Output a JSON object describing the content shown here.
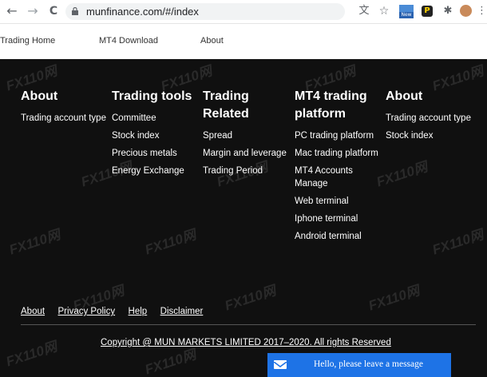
{
  "browser": {
    "back_icon": "←",
    "forward_icon": "→",
    "reload_icon": "C",
    "url": "munfinance.com/#/index",
    "ext_new_badge": "New"
  },
  "nav": {
    "items": [
      "Trading Home",
      "MT4 Download",
      "About"
    ]
  },
  "footer": {
    "columns": [
      {
        "title": "About",
        "items": [
          "Trading account type"
        ]
      },
      {
        "title": "Trading tools",
        "items": [
          "Committee",
          "Stock index",
          "Precious metals",
          "Energy Exchange"
        ]
      },
      {
        "title": "Trading Related",
        "items": [
          "Spread",
          "Margin and leverage",
          "Trading Period"
        ]
      },
      {
        "title": "MT4 trading platform",
        "items": [
          "PC trading platform",
          "Mac trading platform",
          "MT4 Accounts Manage",
          "Web terminal",
          "Iphone terminal",
          "Android terminal"
        ]
      },
      {
        "title": "About",
        "items": [
          "Trading account type",
          "Stock index"
        ]
      }
    ],
    "bottom_links": [
      "About",
      "Privacy Policy",
      "Help",
      "Disclaimer"
    ],
    "copyright": "Copyright @ MUN MARKETS LIMITED 2017–2020. All rights Reserved"
  },
  "watermark": "FX110网",
  "chat": {
    "text": "Hello, please leave a message"
  },
  "colors": {
    "footer_bg": "#101010",
    "chat_bg": "#1e73e6"
  }
}
